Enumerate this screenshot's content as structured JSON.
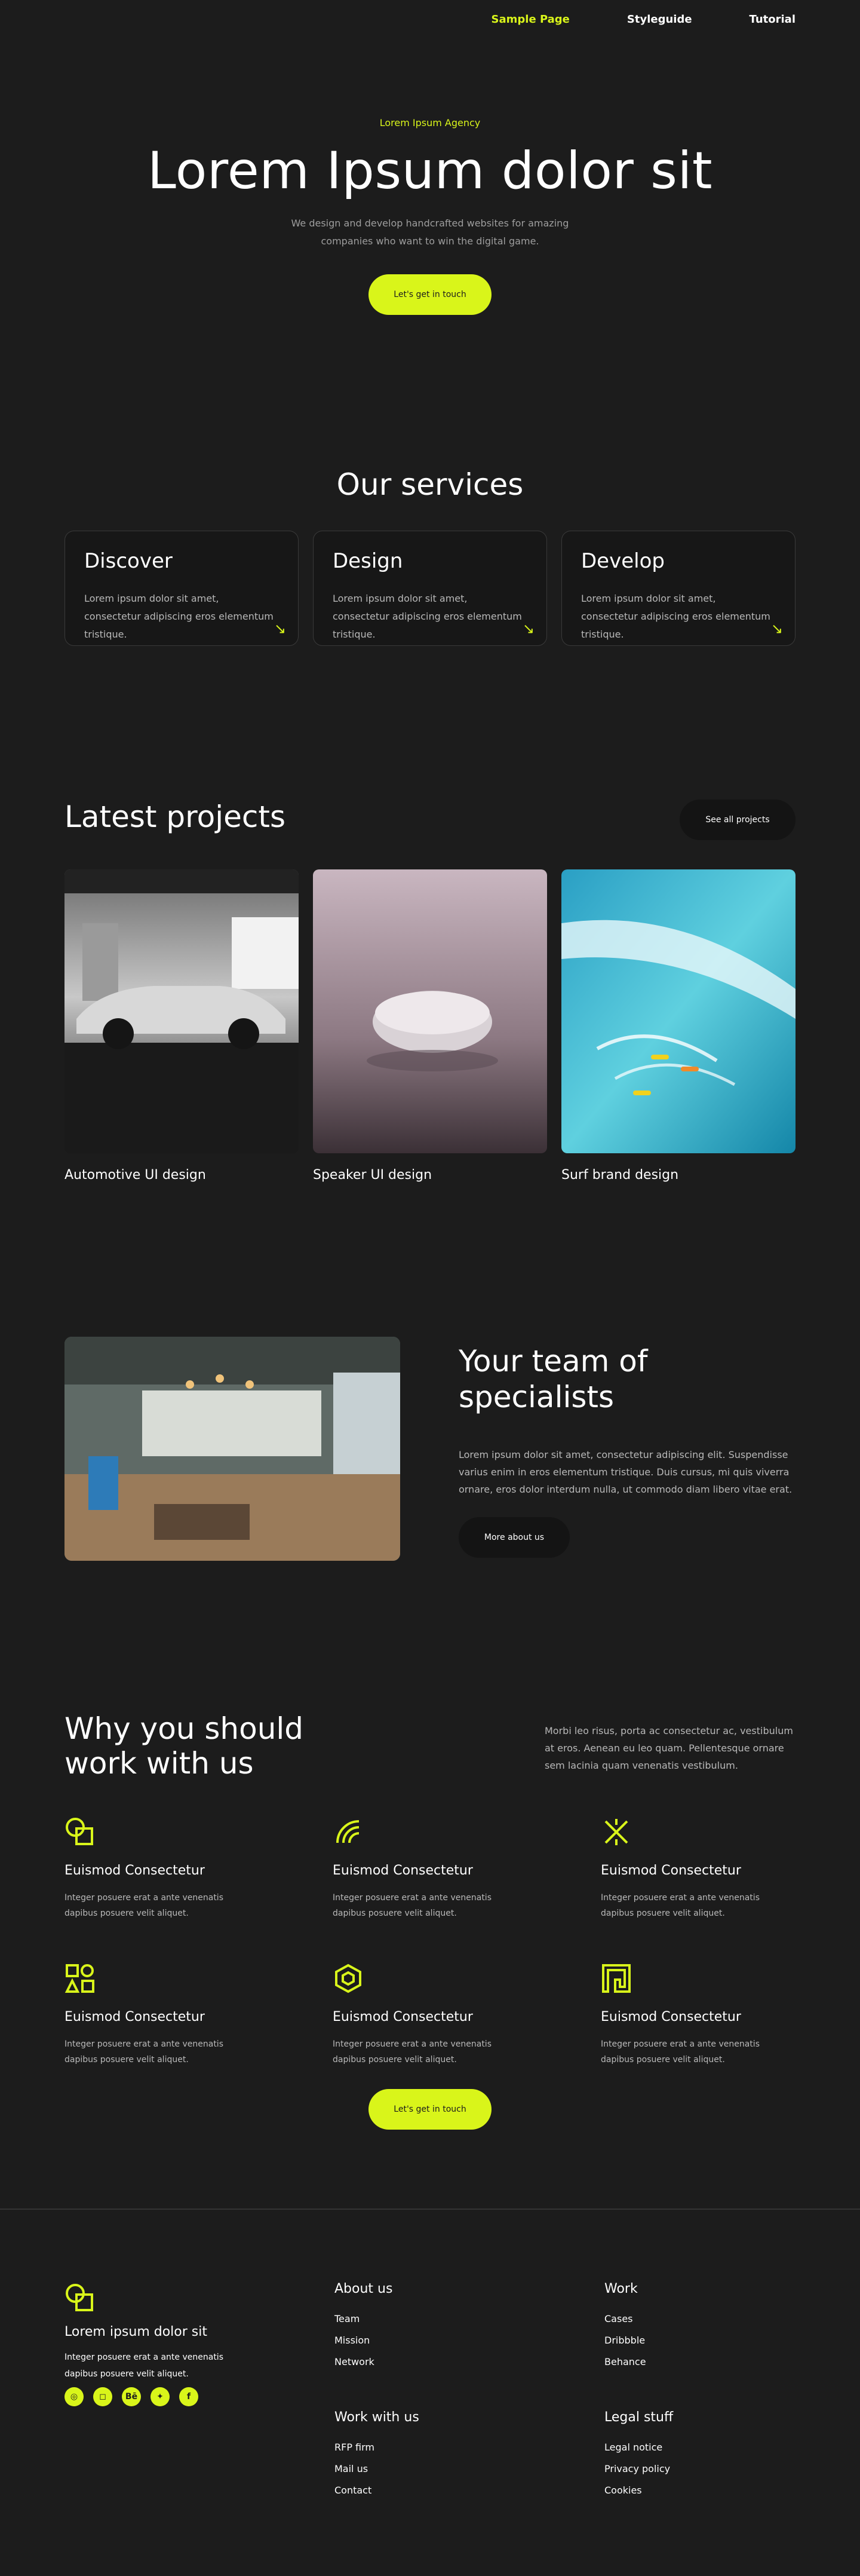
{
  "nav": {
    "items": [
      "Sample Page",
      "Styleguide",
      "Tutorial"
    ]
  },
  "hero": {
    "eyebrow": "Lorem Ipsum Agency",
    "title": "Lorem Ipsum dolor sit",
    "subtitle": "We design and develop handcrafted websites for amazing companies who want to win the digital game.",
    "cta": "Let's get in touch"
  },
  "services": {
    "title": "Our services",
    "cards": [
      {
        "title": "Discover",
        "text": "Lorem ipsum dolor sit amet, consectetur adipiscing  eros elementum tristique."
      },
      {
        "title": "Design",
        "text": "Lorem ipsum dolor sit amet, consectetur adipiscing  eros elementum tristique."
      },
      {
        "title": "Develop",
        "text": "Lorem ipsum dolor sit amet, consectetur adipiscing  eros elementum tristique."
      }
    ]
  },
  "projects": {
    "title": "Latest projects",
    "see_all": "See all projects",
    "items": [
      {
        "label": "Automotive UI design"
      },
      {
        "label": "Speaker UI design"
      },
      {
        "label": "Surf brand design"
      }
    ]
  },
  "team": {
    "title": "Your team of specialists",
    "text": "Lorem ipsum dolor sit amet, consectetur adipiscing elit. Suspendisse varius enim in eros elementum tristique. Duis cursus, mi quis viverra ornare, eros dolor interdum nulla, ut commodo diam libero vitae erat.",
    "button": "More about us"
  },
  "why": {
    "title": "Why you should work with us",
    "text": "Morbi leo risus, porta ac consectetur ac, vestibulum at eros. Aenean eu leo quam. Pellentesque ornare sem lacinia quam venenatis vestibulum.",
    "features": [
      {
        "title": "Euismod Consectetur",
        "text": "Integer posuere erat a ante venenatis dapibus posuere velit aliquet.",
        "icon": "overlapping-squares-circle-icon"
      },
      {
        "title": "Euismod Consectetur",
        "text": "Integer posuere erat a ante venenatis dapibus posuere velit aliquet.",
        "icon": "concentric-arcs-icon"
      },
      {
        "title": "Euismod Consectetur",
        "text": "Integer posuere erat a ante venenatis dapibus posuere velit aliquet.",
        "icon": "cross-arrows-icon"
      },
      {
        "title": "Euismod Consectetur",
        "text": "Integer posuere erat a ante venenatis dapibus posuere velit aliquet.",
        "icon": "shapes-icon"
      },
      {
        "title": "Euismod Consectetur",
        "text": "Integer posuere erat a ante venenatis dapibus posuere velit aliquet.",
        "icon": "hexagon-spiral-icon"
      },
      {
        "title": "Euismod Consectetur",
        "text": "Integer posuere erat a ante venenatis dapibus posuere velit aliquet.",
        "icon": "square-maze-icon"
      }
    ],
    "cta": "Let's get in touch"
  },
  "footer": {
    "brand": {
      "name": "Lorem ipsum dolor sit",
      "text": "Integer posuere erat a ante venenatis dapibus posuere velit aliquet."
    },
    "socials": [
      "dribbble-icon",
      "instagram-icon",
      "behance-icon",
      "twitter-icon",
      "facebook-icon"
    ],
    "columns": [
      {
        "title": "About us",
        "links": [
          "Team",
          "Mission",
          "Network"
        ]
      },
      {
        "title": "Work",
        "links": [
          "Cases",
          "Dribbble",
          "Behance"
        ]
      },
      {
        "title": "Work with us",
        "links": [
          "RFP firm",
          "Mail us",
          "Contact"
        ]
      },
      {
        "title": "Legal stuff",
        "links": [
          "Legal notice",
          "Privacy policy",
          "Cookies"
        ]
      }
    ]
  },
  "colors": {
    "background": "#1c1c1c",
    "accent": "#d9f51a",
    "card": "#171717",
    "muted_text": "#b9b9b9"
  }
}
